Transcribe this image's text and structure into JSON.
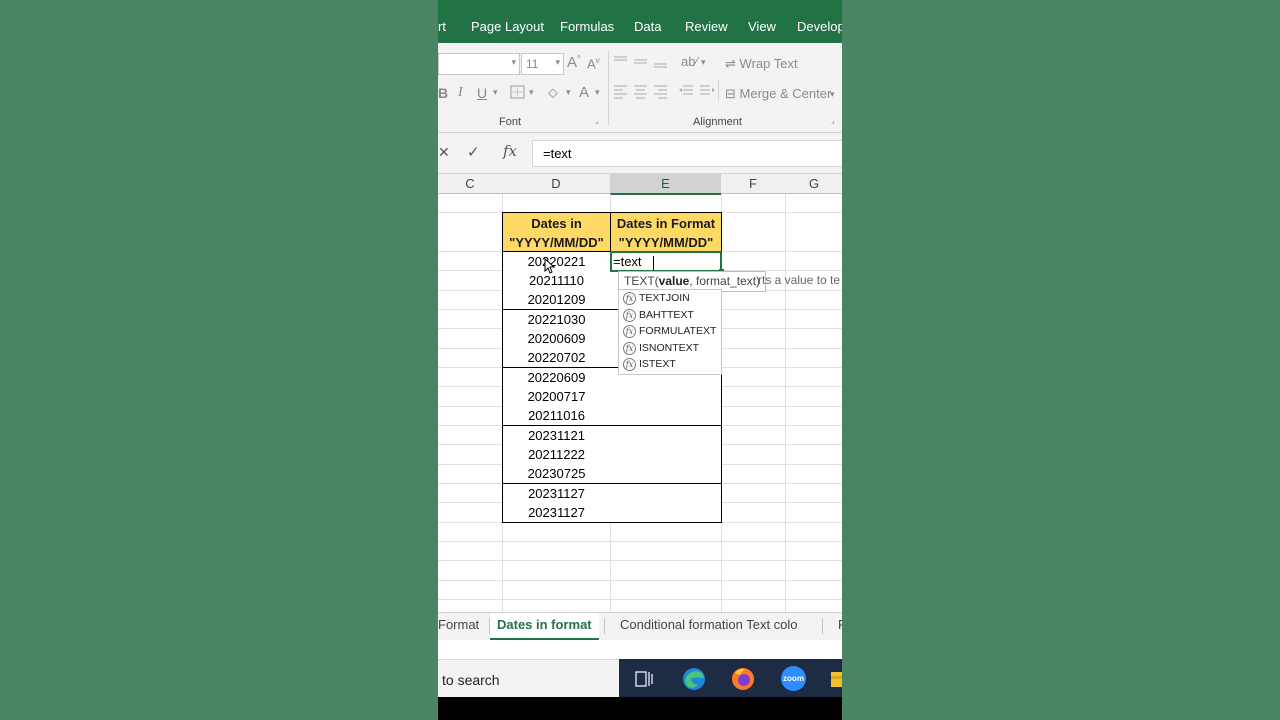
{
  "ribbon": {
    "tabs": [
      "rt",
      "Page Layout",
      "Formulas",
      "Data",
      "Review",
      "View",
      "Develop"
    ],
    "font_size": "11",
    "bold": "B",
    "italic": "I",
    "underline": "U",
    "wrap_text": "Wrap Text",
    "merge_center": "Merge & Center",
    "font_group": "Font",
    "alignment_group": "Alignment"
  },
  "formula_bar": {
    "cancel": "✕",
    "enter": "✓",
    "fx": "fx",
    "value": "=text"
  },
  "columns": [
    "C",
    "D",
    "E",
    "F",
    "G"
  ],
  "selected_column": "E",
  "headers": {
    "d": "Dates in \"YYYY/MM/DD\"",
    "e": "Dates in Format \"YYYY/MM/DD\""
  },
  "dates": [
    "20220221",
    "20211110",
    "20201209",
    "20221030",
    "20200609",
    "20220702",
    "20220609",
    "20200717",
    "20211016",
    "20231121",
    "20211222",
    "20230725",
    "20231127",
    "20231127"
  ],
  "active_cell": {
    "value": "=text"
  },
  "tooltip": {
    "fn": "TEXT(",
    "arg": "value",
    "rest": ", format_text)",
    "description": "rts a value to te"
  },
  "autocomplete": [
    "TEXTJOIN",
    "BAHTTEXT",
    "FORMULATEXT",
    "ISNONTEXT",
    "ISTEXT"
  ],
  "sheet_tabs": {
    "prev": "Format",
    "active": "Dates in format",
    "next": "Conditional formation Text colo",
    "more": "F"
  },
  "taskbar": {
    "search": "to search",
    "zoom": "zoom"
  },
  "colors": {
    "accent": "#217346",
    "header_fill": "#ffd966",
    "background": "#4a8465"
  }
}
